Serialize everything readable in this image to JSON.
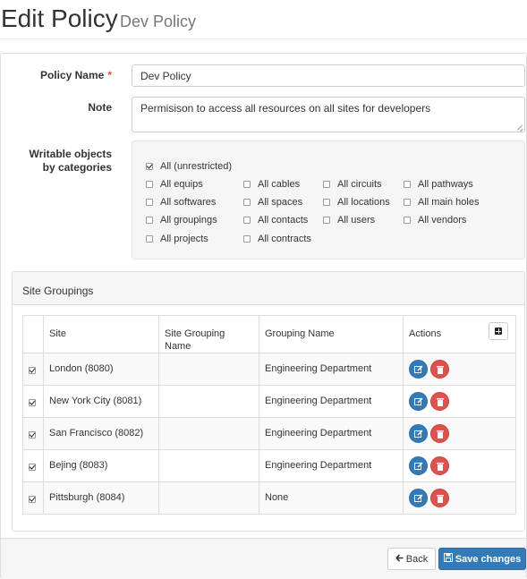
{
  "header": {
    "title": "Edit Policy",
    "subtitle": "Dev Policy"
  },
  "form": {
    "policy_name_label": "Policy Name",
    "required_mark": "*",
    "policy_name_value": "Dev Policy",
    "note_label": "Note",
    "note_value": "Permisison to access all resources on all sites for developers",
    "writable_label": "Writable objects by categories",
    "categories": {
      "all_unrestricted": "All (unrestricted)",
      "all_equips": "All equips",
      "all_cables": "All cables",
      "all_circuits": "All circuits",
      "all_pathways": "All pathways",
      "all_softwares": "All softwares",
      "all_spaces": "All spaces",
      "all_locations": "All locations",
      "all_main_holes": "All main holes",
      "all_groupings": "All groupings",
      "all_contacts": "All contacts",
      "all_users": "All users",
      "all_vendors": "All vendors",
      "all_projects": "All projects",
      "all_contracts": "All contracts"
    }
  },
  "site_groupings": {
    "title": "Site Groupings",
    "columns": [
      "Site",
      "Site Grouping Name",
      "Grouping Name",
      "Actions"
    ],
    "rows": [
      {
        "site": "London (8080)",
        "site_grouping_name": "",
        "grouping_name": "Engineering Department"
      },
      {
        "site": "New York City (8081)",
        "site_grouping_name": "",
        "grouping_name": "Engineering Department"
      },
      {
        "site": "San Francisco (8082)",
        "site_grouping_name": "",
        "grouping_name": "Engineering Department"
      },
      {
        "site": "Bejing (8083)",
        "site_grouping_name": "",
        "grouping_name": "Engineering Department"
      },
      {
        "site": "Pittsburgh (8084)",
        "site_grouping_name": "",
        "grouping_name": "None"
      }
    ]
  },
  "footer": {
    "back_label": "Back",
    "save_label": "Save changes"
  },
  "colors": {
    "primary": "#337ab7",
    "danger": "#d9534f",
    "required": "#d9534f"
  },
  "icons": {
    "add": "plus-square-icon",
    "edit": "edit-icon",
    "delete": "trash-icon",
    "back": "arrow-left-icon",
    "save": "floppy-disk-icon"
  }
}
